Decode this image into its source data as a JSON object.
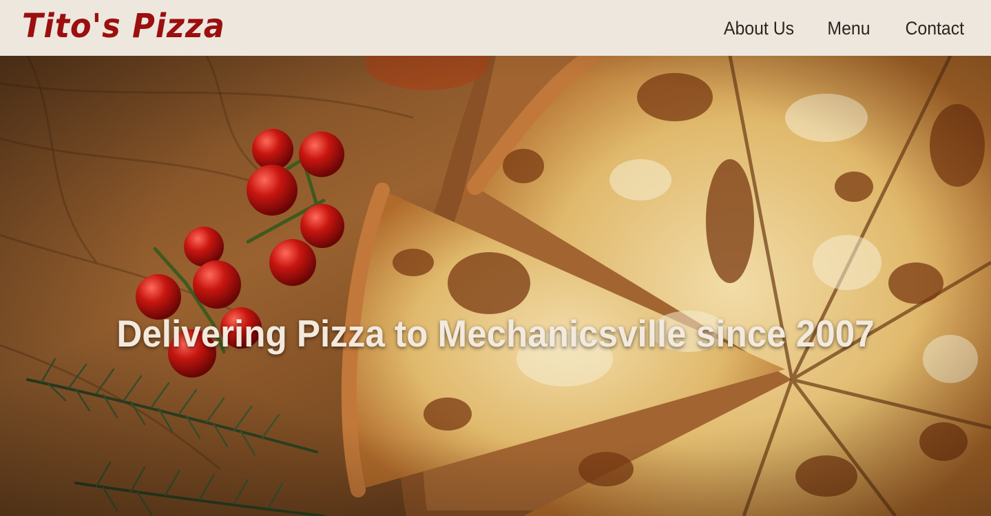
{
  "brand": {
    "name": "Tito's Pizza",
    "color": "#9b0f0f"
  },
  "nav": {
    "items": [
      {
        "label": "About Us"
      },
      {
        "label": "Menu"
      },
      {
        "label": "Contact"
      }
    ]
  },
  "hero": {
    "image_subject": "overhead photo of a sliced cheese pizza on a wooden board with cherry tomatoes and rosemary",
    "tagline": "Delivering Pizza to Mechanicsville since 2007"
  },
  "colors": {
    "header_bg": "#ede7de",
    "nav_text": "#2b2520",
    "tagline_text": "#f3e9dc"
  }
}
